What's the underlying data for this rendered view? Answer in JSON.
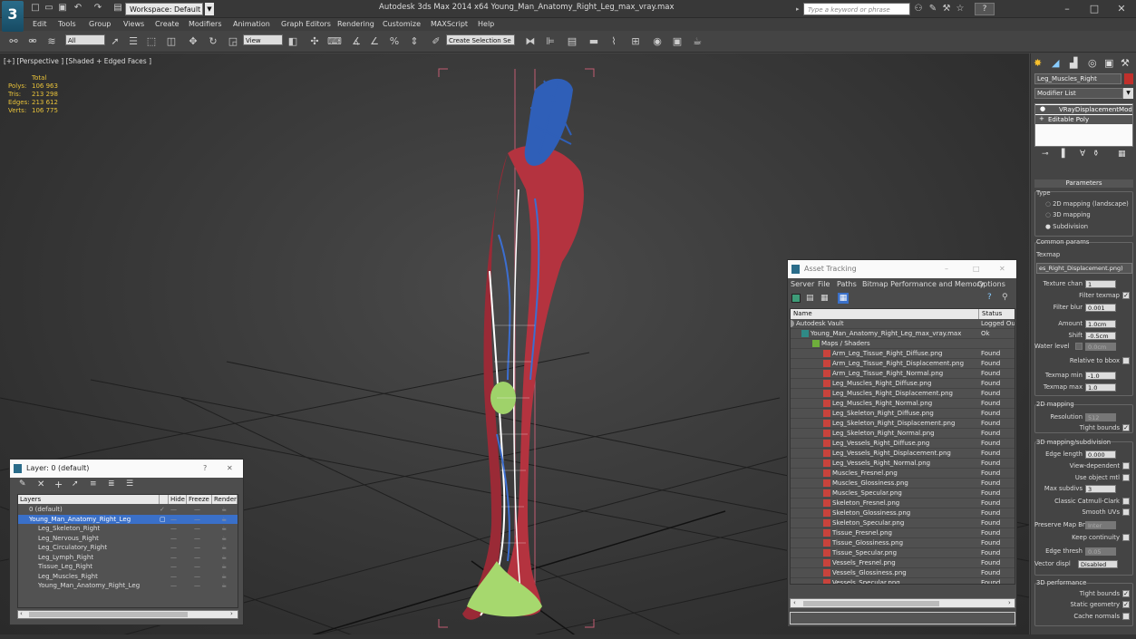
{
  "titlebar": {
    "workspace": "Workspace: Default",
    "app_title": "Autodesk 3ds Max 2014 x64    Young_Man_Anatomy_Right_Leg_max_vray.max",
    "search_placeholder": "Type a keyword or phrase",
    "help": "?"
  },
  "menus": [
    "Edit",
    "Tools",
    "Group",
    "Views",
    "Create",
    "Modifiers",
    "Animation",
    "Graph Editors",
    "Rendering",
    "Customize",
    "MAXScript",
    "Help"
  ],
  "toolbar": {
    "filter_all": "All",
    "view_dropdown": "View",
    "selection_set": "Create Selection Se"
  },
  "viewport": {
    "label": "[+] [Perspective ] [Shaded + Edged Faces ]",
    "stats_header": "Total",
    "stats": [
      {
        "label": "Polys:",
        "value": "106 963"
      },
      {
        "label": "Tris:",
        "value": "213 298"
      },
      {
        "label": "Edges:",
        "value": "213 612"
      },
      {
        "label": "Verts:",
        "value": "106 775"
      }
    ]
  },
  "layer_window": {
    "title": "Layer: 0 (default)",
    "close": "?",
    "columns": [
      "Layers",
      "Hide",
      "Freeze",
      "Render"
    ],
    "rows": [
      {
        "name": "0 (default)"
      },
      {
        "name": "Young_Man_Anatomy_Right_Leg"
      },
      {
        "name": "Leg_Skeleton_Right"
      },
      {
        "name": "Leg_Nervous_Right"
      },
      {
        "name": "Leg_Circulatory_Right"
      },
      {
        "name": "Leg_Lymph_Right"
      },
      {
        "name": "Tissue_Leg_Right"
      },
      {
        "name": "Leg_Muscles_Right"
      },
      {
        "name": "Young_Man_Anatomy_Right_Leg"
      }
    ]
  },
  "asset_window": {
    "title": "Asset Tracking",
    "menus": [
      "Server",
      "File",
      "Paths",
      "Bitmap Performance and Memory",
      "Options"
    ],
    "columns": [
      "Name",
      "Status"
    ],
    "rows": [
      {
        "name": "Autodesk Vault",
        "status": "Logged Ou"
      },
      {
        "name": "Young_Man_Anatomy_Right_Leg_max_vray.max",
        "status": "Ok"
      },
      {
        "name": "Maps / Shaders",
        "status": ""
      },
      {
        "name": "Arm_Leg_Tissue_Right_Diffuse.png",
        "status": "Found"
      },
      {
        "name": "Arm_Leg_Tissue_Right_Displacement.png",
        "status": "Found"
      },
      {
        "name": "Arm_Leg_Tissue_Right_Normal.png",
        "status": "Found"
      },
      {
        "name": "Leg_Muscles_Right_Diffuse.png",
        "status": "Found"
      },
      {
        "name": "Leg_Muscles_Right_Displacement.png",
        "status": "Found"
      },
      {
        "name": "Leg_Muscles_Right_Normal.png",
        "status": "Found"
      },
      {
        "name": "Leg_Skeleton_Right_Diffuse.png",
        "status": "Found"
      },
      {
        "name": "Leg_Skeleton_Right_Displacement.png",
        "status": "Found"
      },
      {
        "name": "Leg_Skeleton_Right_Normal.png",
        "status": "Found"
      },
      {
        "name": "Leg_Vessels_Right_Diffuse.png",
        "status": "Found"
      },
      {
        "name": "Leg_Vessels_Right_Displacement.png",
        "status": "Found"
      },
      {
        "name": "Leg_Vessels_Right_Normal.png",
        "status": "Found"
      },
      {
        "name": "Muscles_Fresnel.png",
        "status": "Found"
      },
      {
        "name": "Muscles_Glossiness.png",
        "status": "Found"
      },
      {
        "name": "Muscles_Specular.png",
        "status": "Found"
      },
      {
        "name": "Skeleton_Fresnel.png",
        "status": "Found"
      },
      {
        "name": "Skeleton_Glossiness.png",
        "status": "Found"
      },
      {
        "name": "Skeleton_Specular.png",
        "status": "Found"
      },
      {
        "name": "Tissue_Fresnel.png",
        "status": "Found"
      },
      {
        "name": "Tissue_Glossiness.png",
        "status": "Found"
      },
      {
        "name": "Tissue_Specular.png",
        "status": "Found"
      },
      {
        "name": "Vessels_Fresnel.png",
        "status": "Found"
      },
      {
        "name": "Vessels_Glossiness.png",
        "status": "Found"
      },
      {
        "name": "Vessels_Specular.png",
        "status": "Found"
      }
    ]
  },
  "command_panel": {
    "object_name": "Leg_Muscles_Right",
    "modifier_list": "Modifier List",
    "stack": [
      "VRayDisplacementMod",
      "Editable Poly"
    ],
    "rollout": "Parameters",
    "type_label": "Type",
    "type_options": [
      "2D mapping (landscape)",
      "3D mapping",
      "Subdivision"
    ],
    "common_params": "Common params",
    "texmap_label": "Texmap",
    "texmap_value": "es_Right_Displacement.png)",
    "texture_chan_label": "Texture chan",
    "texture_chan": "1",
    "filter_texmap": "Filter texmap",
    "filter_blur_label": "Filter blur",
    "filter_blur": "0.001",
    "amount_label": "Amount",
    "amount": "1.0cm",
    "shift_label": "Shift",
    "shift": "-0.5cm",
    "water_level_label": "Water level",
    "water_level": "0.0cm",
    "relative_bbox": "Relative to bbox",
    "texmap_min_label": "Texmap min",
    "texmap_min": "-1.0",
    "texmap_max_label": "Texmap max",
    "texmap_max": "1.0",
    "mapping_2d": "2D mapping",
    "resolution_label": "Resolution",
    "resolution": "512",
    "tight_bounds": "Tight bounds",
    "mapping_3d": "3D mapping/subdivision",
    "edge_length_label": "Edge length",
    "edge_length": "0.000",
    "view_dependent": "View-dependent",
    "use_object_mtl": "Use object mtl",
    "max_subdivs_label": "Max subdivs",
    "max_subdivs": "3",
    "classic_catmull": "Classic Catmull-Clark",
    "smooth_uvs": "Smooth UVs",
    "preserve_map_bnd_label": "Preserve Map Bnd",
    "preserve_map_bnd": "Inter",
    "keep_continuity": "Keep continuity",
    "edge_thresh_label": "Edge thresh",
    "edge_thresh": "0.05",
    "vector_displ_label": "Vector displ",
    "vector_displ": "Disabled",
    "performance": "3D performance",
    "tight_bounds_perf": "Tight bounds",
    "static_geometry": "Static geometry",
    "cache_normals": "Cache normals"
  }
}
